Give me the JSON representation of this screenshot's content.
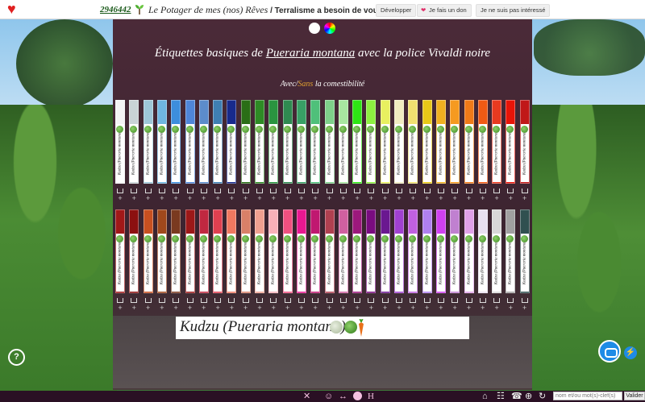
{
  "topbar": {
    "counter": "2946442",
    "title_italic": "Le Potager de mes (nos) Rêves",
    "title_sep": " / ",
    "title_bold": "Terralisme a besoin de vous",
    "buttons": [
      "Développer",
      "Je fais un don",
      "Je ne suis pas intéressé"
    ]
  },
  "panel": {
    "headline_before": "Étiquettes basiques de ",
    "headline_link": "Pueraria montana",
    "headline_after": " avec la police Vivaldi noire",
    "sub_avec": "Avec",
    "sub_slash": "/",
    "sub_sans": "Sans",
    "sub_rest": " la comestibilité",
    "strip_label": "Kudzu (Pueraria montana)"
  },
  "colors_row1": [
    "#f4f4f4",
    "#c9d4d6",
    "#9ec7d8",
    "#6fb6e0",
    "#3d8edc",
    "#4f86d8",
    "#5c8ccb",
    "#3f7fb3",
    "#182a8c",
    "#2a6e16",
    "#2e8b25",
    "#2a9440",
    "#2f8a50",
    "#38a065",
    "#4fc07a",
    "#7ed08a",
    "#a8e6a0",
    "#2ee614",
    "#8cf040",
    "#e8f060",
    "#f0ecc0",
    "#f0e070",
    "#e8c818",
    "#f0b020",
    "#f59a20",
    "#f07a18",
    "#f05a14",
    "#e83a20",
    "#e81408",
    "#c01818"
  ],
  "colors_row2": [
    "#a01818",
    "#8c1010",
    "#c85020",
    "#a0481c",
    "#7a3a20",
    "#9c1818",
    "#c02840",
    "#e04050",
    "#f07860",
    "#d88068",
    "#f0a090",
    "#f8b0b8",
    "#f05080",
    "#e81890",
    "#c01870",
    "#b04050",
    "#d060a0",
    "#9c187c",
    "#7a0c80",
    "#6a1890",
    "#a040d0",
    "#c060e0",
    "#b080f0",
    "#d040f0",
    "#c080d0",
    "#e0a0e8",
    "#e8e0f0",
    "#d8d8d8",
    "#a0a0a0",
    "#305050"
  ],
  "preview": {
    "text": "Kudzu (Pueraria montana)"
  },
  "bottombar": {
    "search_placeholder": "nom et/ou mot(s)-clef(s)",
    "validate_label": "Valider"
  },
  "help": {
    "label": "?"
  }
}
